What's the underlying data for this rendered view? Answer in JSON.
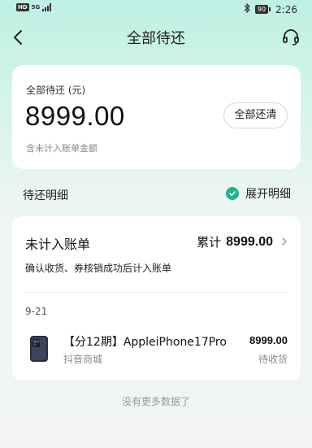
{
  "status_bar": {
    "hd_label": "HD",
    "network_label": "5G",
    "battery": "90",
    "time": "2:26"
  },
  "nav": {
    "title": "全部待还",
    "back_icon": "chevron-left-icon",
    "headset_icon": "headset-icon"
  },
  "summary": {
    "label": "全部待还 (元)",
    "amount": "8999.00",
    "note": "含未计入账单金额",
    "payoff_button": "全部还清"
  },
  "detail": {
    "title": "待还明细",
    "expand_label": "展开明细",
    "expand_checked": true,
    "accent_color": "#1fb58e"
  },
  "bill": {
    "type": "未计入账单",
    "total_label": "累计",
    "total_amount": "8999.00",
    "description": "确认收货、券核销成功后计入账单",
    "date": "9-21",
    "order": {
      "name": "【分12期】AppleiPhone17Pro",
      "shop": "抖音商城",
      "amount": "8999.00",
      "status": "待收货"
    }
  },
  "footer": {
    "note": "没有更多数据了"
  }
}
